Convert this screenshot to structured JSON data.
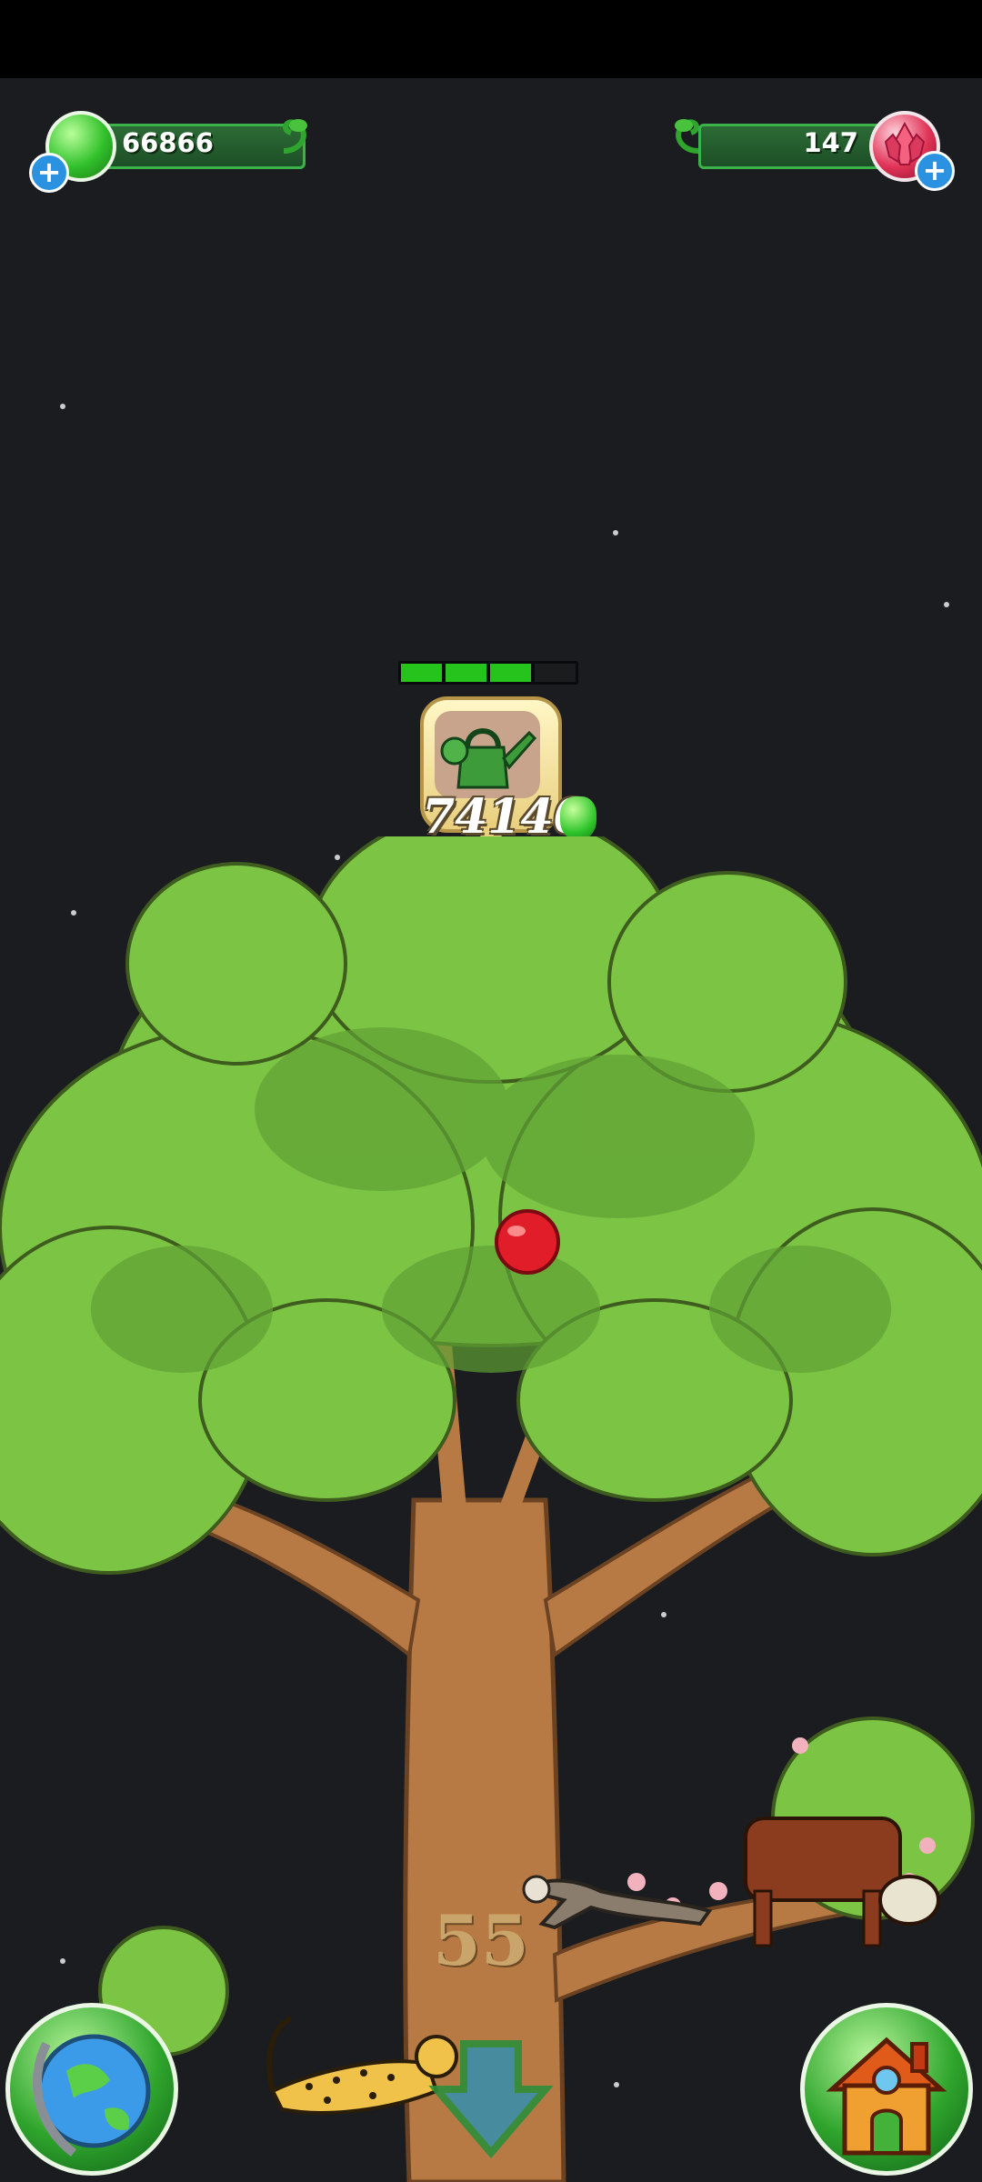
{
  "hud": {
    "jelly": {
      "amount": "66866",
      "icon": "green-jelly-icon",
      "add_icon": "plus-icon"
    },
    "gems": {
      "amount": "147",
      "icon": "red-crystal-icon",
      "add_icon": "plus-icon"
    }
  },
  "upgrade": {
    "progress_segments_total": 4,
    "progress_segments_filled": 3,
    "icon": "watering-can-icon",
    "cost": "74140",
    "cost_icon": "green-jelly-icon"
  },
  "tree": {
    "level": "55",
    "fruit_icon": "red-apple-icon",
    "animals": [
      "ferret",
      "cow",
      "cheetah"
    ]
  },
  "nav": {
    "left_icon": "globe-icon",
    "center_icon": "down-arrow-icon",
    "right_icon": "house-icon"
  },
  "colors": {
    "leaf": "#7cc444",
    "trunk": "#b87a45",
    "jelly": "#31c02b",
    "background": "#1a1c20"
  }
}
